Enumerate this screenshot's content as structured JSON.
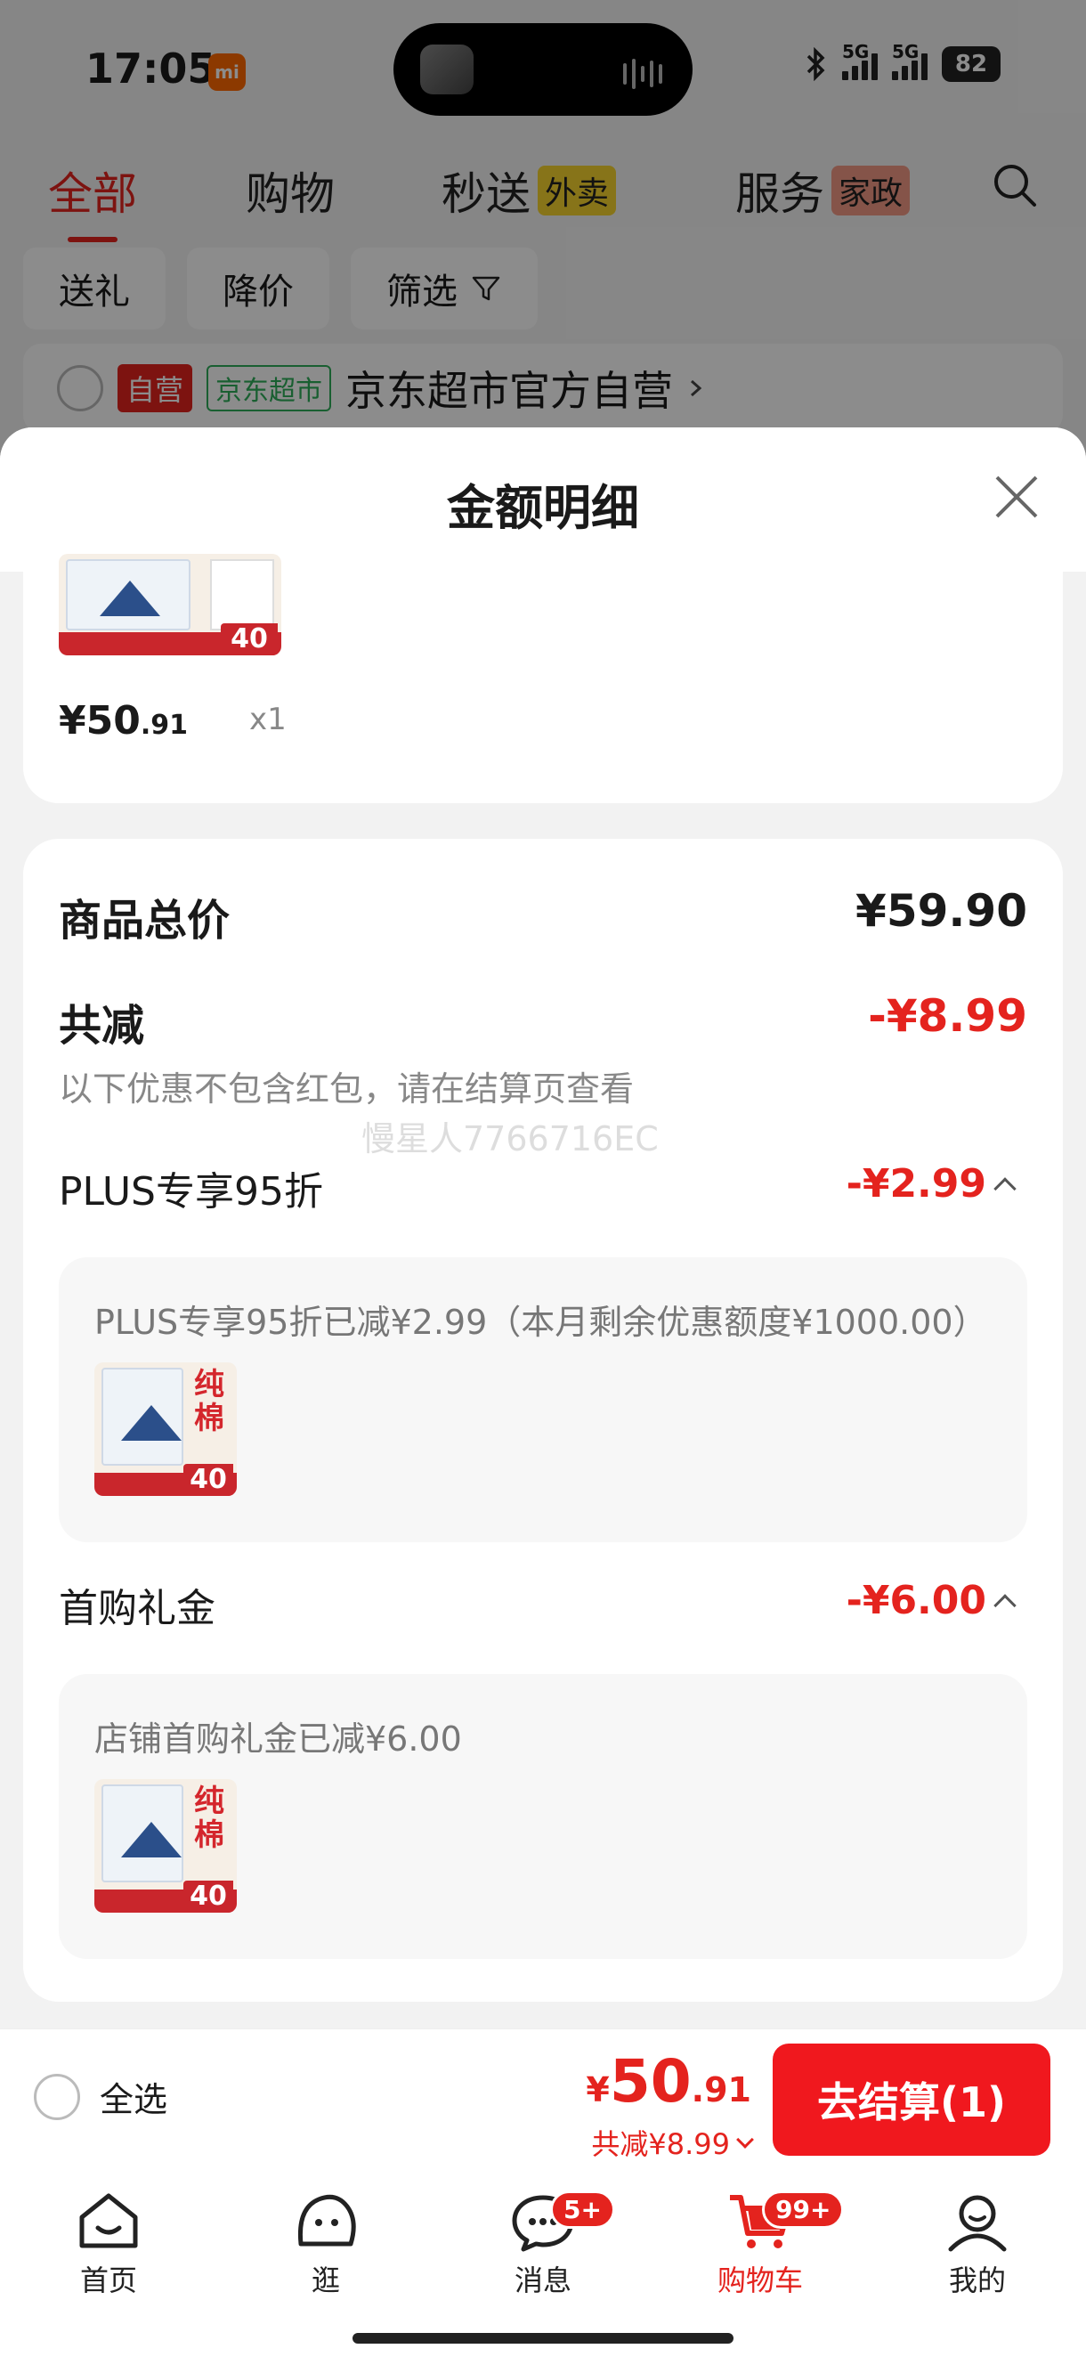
{
  "status_bar": {
    "time": "17:05",
    "mi_label": "mi",
    "battery": "82",
    "network": "5G"
  },
  "top_tabs": [
    {
      "label": "全部",
      "badge": ""
    },
    {
      "label": "购物",
      "badge": ""
    },
    {
      "label": "秒送",
      "badge": "外卖"
    },
    {
      "label": "服务",
      "badge": "家政"
    }
  ],
  "filters": [
    "送礼",
    "降价",
    "筛选"
  ],
  "store": {
    "tag_self": "自营",
    "tag_market": "京东超市",
    "name": "京东超市官方自营"
  },
  "sheet": {
    "title": "金额明细",
    "product": {
      "price_int": "¥50",
      "price_dec": ".91",
      "qty": "x1",
      "thumb_label": "纯棉",
      "thumb_count": "40"
    },
    "summary": {
      "total_label": "商品总价",
      "total_value": "¥59.90",
      "discount_label": "共减",
      "discount_value": "-¥8.99",
      "note": "以下优惠不包含红包，请在结算页查看",
      "watermark": "慢星人7766716EC"
    },
    "discounts": [
      {
        "label": "PLUS专享95折",
        "value": "-¥2.99",
        "detail": "PLUS专享95折已减¥2.99（本月剩余优惠额度¥1000.00）"
      },
      {
        "label": "首购礼金",
        "value": "-¥6.00",
        "detail": "店铺首购礼金已减¥6.00"
      }
    ]
  },
  "checkout": {
    "select_all": "全选",
    "currency": "¥",
    "total_int": "50",
    "total_dec": ".91",
    "saved": "共减¥8.99",
    "button": "去结算(1)"
  },
  "nav": [
    {
      "label": "首页",
      "badge": ""
    },
    {
      "label": "逛",
      "badge": ""
    },
    {
      "label": "消息",
      "badge": "5+"
    },
    {
      "label": "购物车",
      "badge": "99+"
    },
    {
      "label": "我的",
      "badge": ""
    }
  ],
  "colors": {
    "accent": "#e4231e",
    "button": "#f0181e",
    "green_tag": "#2fae5a"
  }
}
